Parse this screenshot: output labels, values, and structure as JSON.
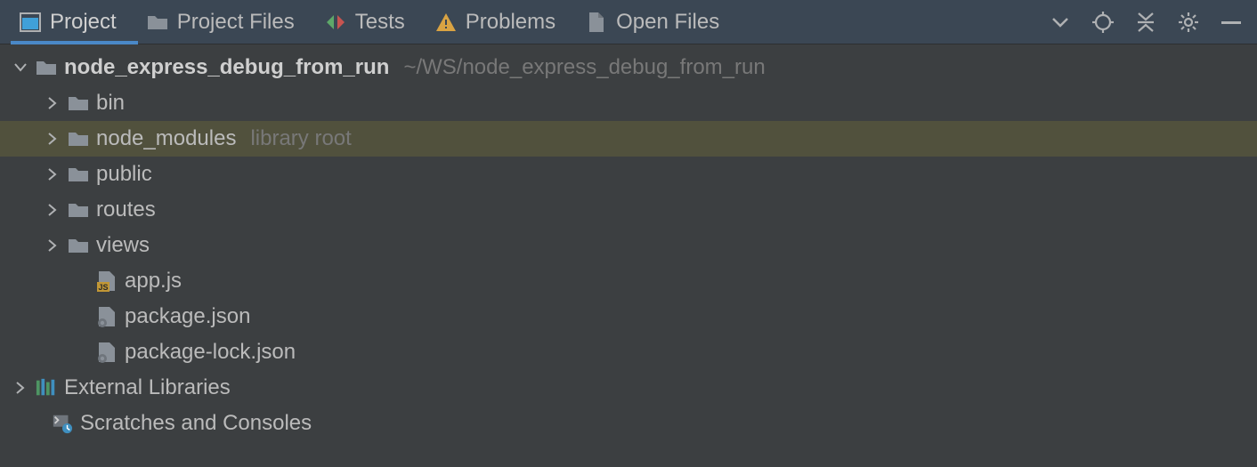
{
  "tabs": [
    {
      "label": "Project",
      "icon": "project-tool-icon"
    },
    {
      "label": "Project Files",
      "icon": "folder-icon"
    },
    {
      "label": "Tests",
      "icon": "tests-icon"
    },
    {
      "label": "Problems",
      "icon": "warning-icon"
    },
    {
      "label": "Open Files",
      "icon": "file-icon"
    }
  ],
  "tree": {
    "root": {
      "name": "node_express_debug_from_run",
      "path": "~/WS/node_express_debug_from_run"
    },
    "children": [
      {
        "name": "bin",
        "kind": "folder"
      },
      {
        "name": "node_modules",
        "kind": "folder",
        "hint": "library root",
        "selected": true
      },
      {
        "name": "public",
        "kind": "folder"
      },
      {
        "name": "routes",
        "kind": "folder"
      },
      {
        "name": "views",
        "kind": "folder"
      },
      {
        "name": "app.js",
        "kind": "file-js"
      },
      {
        "name": "package.json",
        "kind": "file-json"
      },
      {
        "name": "package-lock.json",
        "kind": "file-json"
      }
    ],
    "extra": [
      {
        "name": "External Libraries",
        "kind": "libraries"
      },
      {
        "name": "Scratches and Consoles",
        "kind": "scratches"
      }
    ]
  }
}
